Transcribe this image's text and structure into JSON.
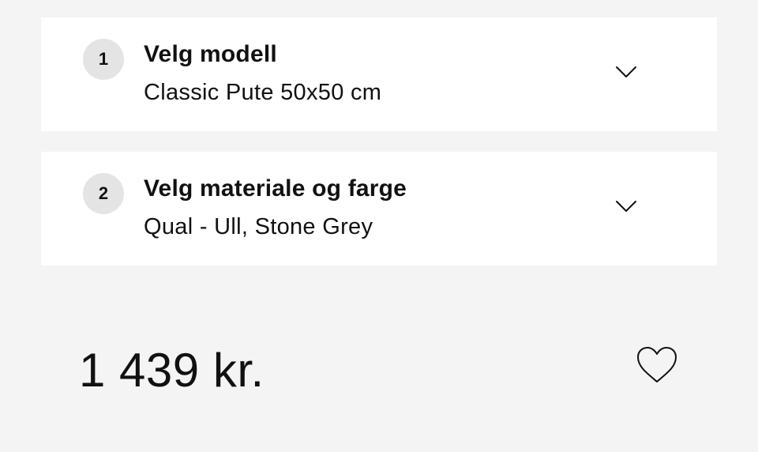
{
  "steps": [
    {
      "number": "1",
      "title": "Velg modell",
      "value": "Classic Pute 50x50 cm",
      "icon": "chevron-down-icon"
    },
    {
      "number": "2",
      "title": "Velg materiale og farge",
      "value": "Qual - Ull, Stone Grey",
      "icon": "chevron-down-icon"
    }
  ],
  "price": {
    "text": "1 439 kr."
  },
  "wishlist": {
    "icon": "heart-icon"
  },
  "colors": {
    "background": "#f4f4f4",
    "card": "#ffffff",
    "badge": "#e4e4e4",
    "text": "#111111"
  }
}
